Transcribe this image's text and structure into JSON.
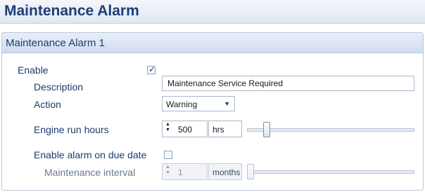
{
  "header": {
    "title": "Maintenance Alarm"
  },
  "panel": {
    "title": "Maintenance Alarm 1",
    "enable": {
      "label": "Enable",
      "checked": true
    },
    "description": {
      "label": "Description",
      "value": "Maintenance Service Required"
    },
    "action": {
      "label": "Action",
      "selected": "Warning"
    },
    "engine_run_hours": {
      "label": "Engine run hours",
      "value": "500",
      "unit": "hrs",
      "slider_fraction": 0.1
    },
    "enable_due_date": {
      "label": "Enable alarm on due date",
      "checked": false
    },
    "maintenance_interval": {
      "label": "Maintenance interval",
      "value": "1",
      "unit": "months",
      "enabled": false,
      "slider_fraction": 0.0
    }
  },
  "icons": {
    "checkmark": "✓",
    "spin_arrows": "▲▼",
    "dropdown_arrow": "▼"
  }
}
